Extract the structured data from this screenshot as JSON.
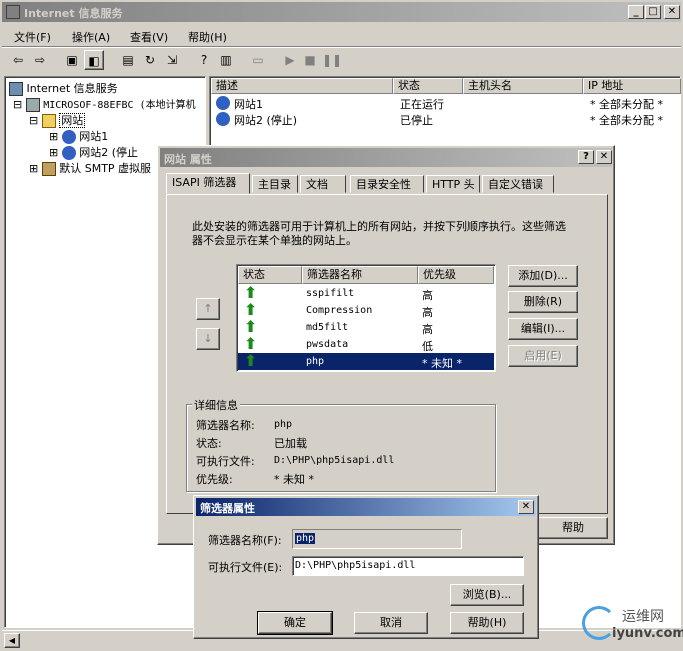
{
  "main_window": {
    "title": "Internet 信息服务",
    "menu": [
      "文件(F)",
      "操作(A)",
      "查看(V)",
      "帮助(H)"
    ],
    "list_columns": [
      "描述",
      "状态",
      "主机头名",
      "IP 地址"
    ],
    "list_rows": [
      {
        "desc": "网站1",
        "status": "正在运行",
        "host": "",
        "ip": "* 全部未分配 *"
      },
      {
        "desc": "网站2 (停止)",
        "status": "已停止",
        "host": "",
        "ip": "* 全部未分配 *"
      }
    ],
    "tree": {
      "root": "Internet 信息服务",
      "computer": "MICROSOF-88EFBC (本地计算机",
      "sites_folder": "网站",
      "site1": "网站1",
      "site2": "网站2 (停止",
      "smtp": "默认 SMTP 虚拟服"
    }
  },
  "props_dialog": {
    "title": "网站 属性",
    "tabs": [
      "ISAPI 筛选器",
      "主目录",
      "文档",
      "目录安全性",
      "HTTP 头",
      "自定义错误"
    ],
    "description": "此处安装的筛选器可用于计算机上的所有网站，并按下列顺序执行。这些筛选器不会显示在某个单独的网站上。",
    "filter_columns": [
      "状态",
      "筛选器名称",
      "优先级"
    ],
    "filters": [
      {
        "name": "sspifilt",
        "priority": "高"
      },
      {
        "name": "Compression",
        "priority": "高"
      },
      {
        "name": "md5filt",
        "priority": "高"
      },
      {
        "name": "pwsdata",
        "priority": "低"
      },
      {
        "name": "php",
        "priority": "* 未知 *"
      }
    ],
    "buttons": {
      "add": "添加(D)...",
      "remove": "删除(R)",
      "edit": "编辑(I)...",
      "enable": "启用(E)",
      "help": "帮助"
    },
    "move_up": "↑",
    "move_down": "↓",
    "details": {
      "label": "详细信息",
      "name_label": "筛选器名称:",
      "name_value": "php",
      "status_label": "状态:",
      "status_value": "已加载",
      "exe_label": "可执行文件:",
      "exe_value": "D:\\PHP\\php5isapi.dll",
      "priority_label": "优先级:",
      "priority_value": "* 未知 *"
    }
  },
  "filter_dialog": {
    "title": "筛选器属性",
    "name_label": "筛选器名称(F):",
    "name_value": "php",
    "exe_label": "可执行文件(E):",
    "exe_value": "D:\\PHP\\php5isapi.dll",
    "browse": "浏览(B)...",
    "ok": "确定",
    "cancel": "取消",
    "help": "帮助(H)"
  },
  "watermark": {
    "text": "运维网",
    "url": "iyunv.com"
  },
  "colors": {
    "selection": "#0a246a",
    "arrow_green": "#1a8a1a",
    "active_title": "#0a246a",
    "inactive_title": "#808080"
  }
}
